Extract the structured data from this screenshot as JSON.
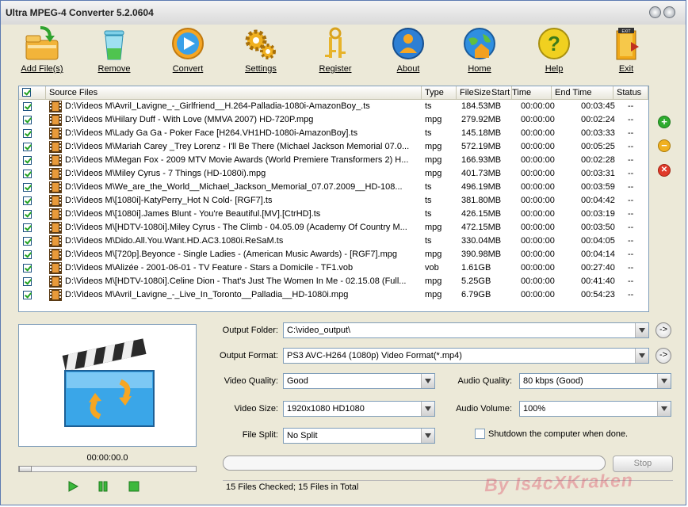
{
  "window": {
    "title": "Ultra MPEG-4 Converter 5.2.0604"
  },
  "toolbar": [
    {
      "label": "Add File(s)",
      "icon": "add-files-icon"
    },
    {
      "label": "Remove",
      "icon": "trash-icon"
    },
    {
      "label": "Convert",
      "icon": "play-convert-icon"
    },
    {
      "label": "Settings",
      "icon": "gears-icon"
    },
    {
      "label": "Register",
      "icon": "keys-icon"
    },
    {
      "label": "About",
      "icon": "user-icon"
    },
    {
      "label": "Home",
      "icon": "globe-home-icon"
    },
    {
      "label": "Help",
      "icon": "help-icon"
    },
    {
      "label": "Exit",
      "icon": "exit-door-icon"
    }
  ],
  "filelist": {
    "columns": [
      "Source Files",
      "Type",
      "FileSize",
      "Start Time",
      "End Time",
      "Status"
    ],
    "rows": [
      {
        "file": "D:\\Videos M\\Avril_Lavigne_-_Girlfriend__H.264-Palladia-1080i-AmazonBoy_.ts",
        "type": "ts",
        "size": "184.53MB",
        "start": "00:00:00",
        "end": "00:03:45",
        "status": "--"
      },
      {
        "file": "D:\\Videos M\\Hilary Duff - With Love (MMVA 2007) HD-720P.mpg",
        "type": "mpg",
        "size": "279.92MB",
        "start": "00:00:00",
        "end": "00:02:24",
        "status": "--"
      },
      {
        "file": "D:\\Videos M\\Lady Ga Ga - Poker Face [H264.VH1HD-1080i-AmazonBoy].ts",
        "type": "ts",
        "size": "145.18MB",
        "start": "00:00:00",
        "end": "00:03:33",
        "status": "--"
      },
      {
        "file": "D:\\Videos M\\Mariah Carey _Trey Lorenz - I'll Be There (Michael Jackson Memorial 07.0...",
        "type": "mpg",
        "size": "572.19MB",
        "start": "00:00:00",
        "end": "00:05:25",
        "status": "--"
      },
      {
        "file": "D:\\Videos M\\Megan Fox - 2009 MTV Movie Awards (World Premiere Transformers 2) H...",
        "type": "mpg",
        "size": "166.93MB",
        "start": "00:00:00",
        "end": "00:02:28",
        "status": "--"
      },
      {
        "file": "D:\\Videos M\\Miley Cyrus - 7 Things (HD-1080i).mpg",
        "type": "mpg",
        "size": "401.73MB",
        "start": "00:00:00",
        "end": "00:03:31",
        "status": "--"
      },
      {
        "file": "D:\\Videos M\\We_are_the_World__Michael_Jackson_Memorial_07.07.2009__HD-108...",
        "type": "ts",
        "size": "496.19MB",
        "start": "00:00:00",
        "end": "00:03:59",
        "status": "--"
      },
      {
        "file": "D:\\Videos M\\[1080i]-KatyPerry_Hot N Cold- [RGF7].ts",
        "type": "ts",
        "size": "381.80MB",
        "start": "00:00:00",
        "end": "00:04:42",
        "status": "--"
      },
      {
        "file": "D:\\Videos M\\[1080i].James Blunt - You're Beautiful.[MV].[CtrHD].ts",
        "type": "ts",
        "size": "426.15MB",
        "start": "00:00:00",
        "end": "00:03:19",
        "status": "--"
      },
      {
        "file": "D:\\Videos M\\[HDTV-1080i].Miley Cyrus - The Climb - 04.05.09 (Academy Of Country M...",
        "type": "mpg",
        "size": "472.15MB",
        "start": "00:00:00",
        "end": "00:03:50",
        "status": "--"
      },
      {
        "file": "D:\\Videos M\\Dido.All.You.Want.HD.AC3.1080i.ReSaM.ts",
        "type": "ts",
        "size": "330.04MB",
        "start": "00:00:00",
        "end": "00:04:05",
        "status": "--"
      },
      {
        "file": "D:\\Videos M\\[720p].Beyonce - Single Ladies - (American Music Awards) - [RGF7].mpg",
        "type": "mpg",
        "size": "390.98MB",
        "start": "00:00:00",
        "end": "00:04:14",
        "status": "--"
      },
      {
        "file": "D:\\Videos M\\Alizée - 2001-06-01 - TV Feature - Stars a Domicile - TF1.vob",
        "type": "vob",
        "size": "1.61GB",
        "start": "00:00:00",
        "end": "00:27:40",
        "status": "--"
      },
      {
        "file": "D:\\Videos M\\[HDTV-1080i].Celine Dion - That's Just The Women In Me - 02.15.08 (Full...",
        "type": "mpg",
        "size": "5.25GB",
        "start": "00:00:00",
        "end": "00:41:40",
        "status": "--"
      },
      {
        "file": "D:\\Videos M\\Avril_Lavigne_-_Live_In_Toronto__Palladia__HD-1080i.mpg",
        "type": "mpg",
        "size": "6.79GB",
        "start": "00:00:00",
        "end": "00:54:23",
        "status": "--"
      }
    ]
  },
  "player": {
    "time": "00:00:00.0"
  },
  "settings": {
    "output_folder_label": "Output Folder:",
    "output_folder": "C:\\video_output\\",
    "output_format_label": "Output Format:",
    "output_format": "PS3 AVC-H264 (1080p) Video Format(*.mp4)",
    "video_quality_label": "Video Quality:",
    "video_quality": "Good",
    "audio_quality_label": "Audio Quality:",
    "audio_quality": "80  kbps (Good)",
    "video_size_label": "Video Size:",
    "video_size": "1920x1080  HD1080",
    "audio_volume_label": "Audio Volume:",
    "audio_volume": "100%",
    "file_split_label": "File Split:",
    "file_split": "No Split",
    "shutdown_label": "Shutdown the computer when done."
  },
  "actions": {
    "stop_label": "Stop",
    "browse_label": "->"
  },
  "status": {
    "text": "15 Files Checked; 15 Files in Total"
  },
  "watermark": "By Is4cXKraken"
}
